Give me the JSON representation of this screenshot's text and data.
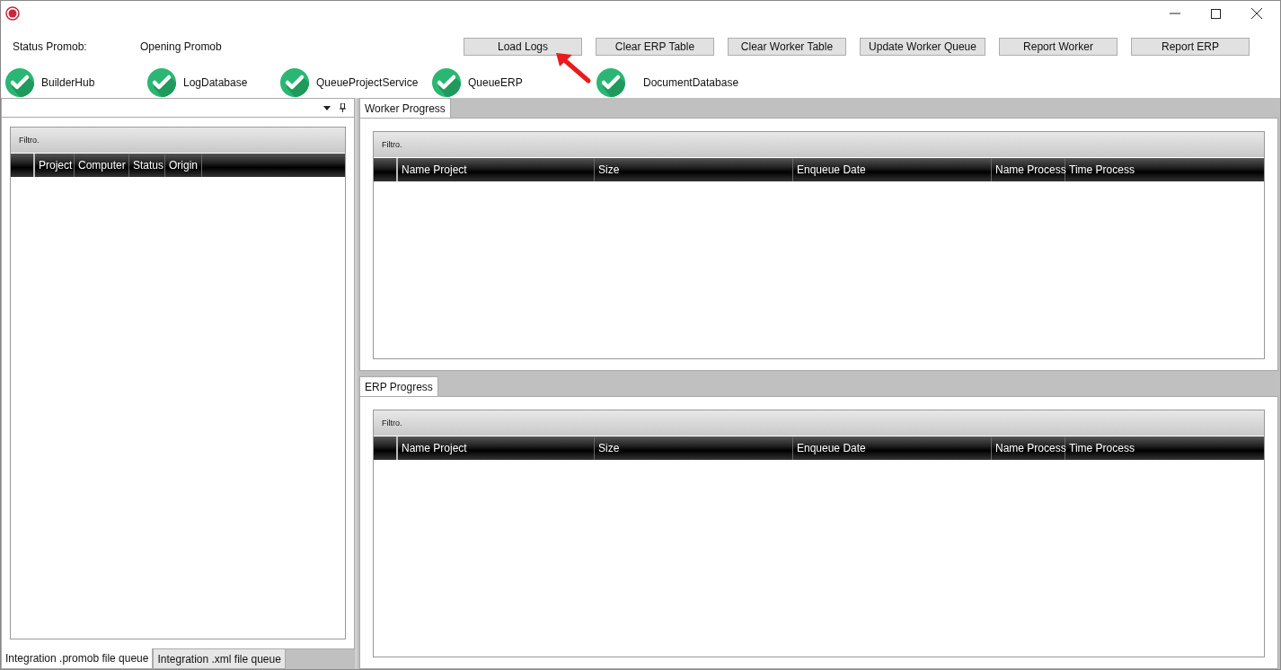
{
  "status": {
    "label": "Status Promob:",
    "value": "Opening Promob"
  },
  "buttons": [
    "Load Logs",
    "Clear ERP Table",
    "Clear Worker Table",
    "Update Worker Queue",
    "Report Worker",
    "Report ERP"
  ],
  "services": [
    {
      "name": "BuilderHub",
      "ok": true
    },
    {
      "name": "LogDatabase",
      "ok": true
    },
    {
      "name": "QueueProjectService",
      "ok": true
    },
    {
      "name": "QueueERP",
      "ok": true
    },
    {
      "name": "DocumentDatabase",
      "ok": true
    }
  ],
  "left_panel": {
    "filter": "Filtro.",
    "columns": [
      "Project",
      "Computer",
      "Status",
      "Origin"
    ],
    "tabs": [
      {
        "label": "Integration .promob file queue",
        "selected": true
      },
      {
        "label": "Integration .xml file queue",
        "selected": false
      }
    ]
  },
  "right_panels": [
    {
      "tab": "Worker Progress",
      "filter": "Filtro.",
      "columns": [
        "Name Project",
        "Size",
        "Enqueue Date",
        "Name Process",
        "Time Process"
      ]
    },
    {
      "tab": "ERP Progress",
      "filter": "Filtro.",
      "columns": [
        "Name Project",
        "Size",
        "Enqueue Date",
        "Name Process",
        "Time Process"
      ]
    }
  ]
}
